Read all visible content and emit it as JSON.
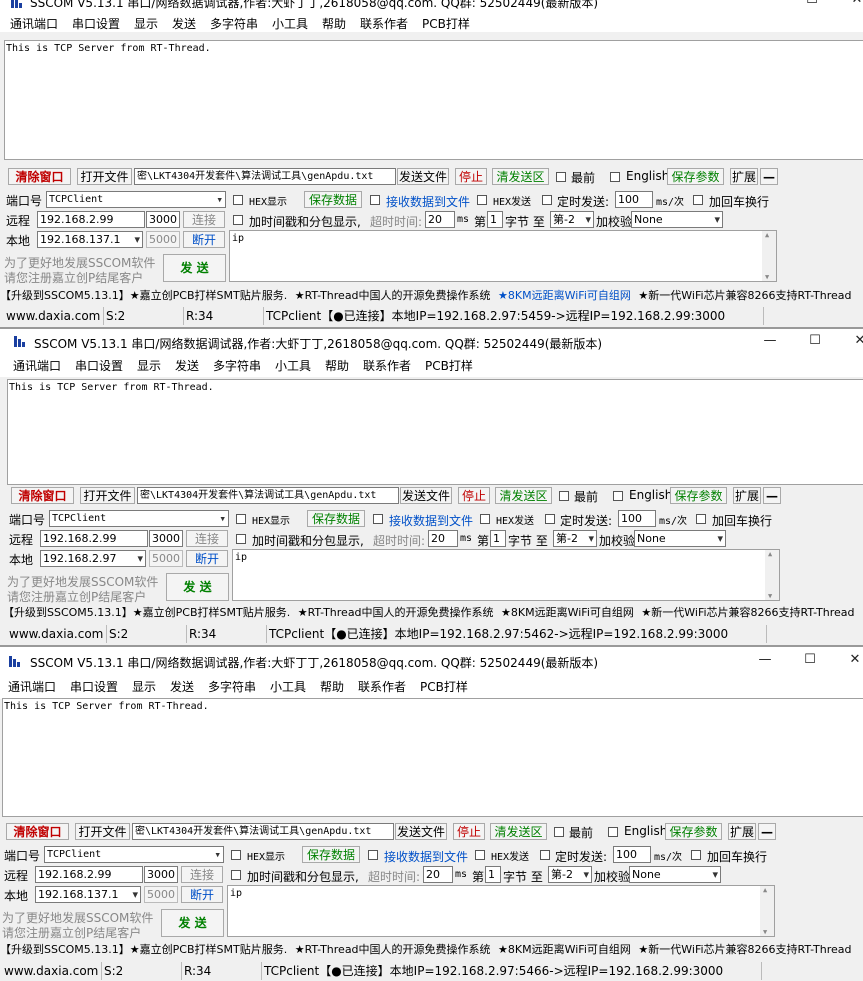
{
  "app": {
    "title": "SSCOM V5.13.1 串口/网络数据调试器,作者:大虾丁丁,2618058@qq.com. QQ群: 52502449(最新版本)",
    "win_min": "—",
    "win_max": "☐",
    "win_close": "✕"
  },
  "menu": [
    "通讯端口",
    "串口设置",
    "显示",
    "发送",
    "多字符串",
    "小工具",
    "帮助",
    "联系作者",
    "PCB打样"
  ],
  "receive_text": "This is TCP Server from RT-Thread.",
  "toolbar": {
    "clear_window": "清除窗口",
    "open_file": "打开文件",
    "file_path": "密\\LKT4304开发套件\\算法调试工具\\genApdu.txt",
    "send_file": "发送文件",
    "stop": "停止",
    "clear_send": "清发送区",
    "topmost": "最前",
    "english": "English",
    "save_params": "保存参数",
    "expand": "扩展",
    "collapse": "—"
  },
  "settings": {
    "port_label": "端口号",
    "port_value": "TCPClient",
    "remote_label": "远程",
    "remote_ip": "192.168.2.99",
    "remote_port": "3000",
    "connect_btn": "连接",
    "local_label": "本地",
    "local_port": "5000",
    "disconnect_btn": "断开",
    "hex_display": "HEX显示",
    "save_data": "保存数据",
    "recv_to_file": "接收数据到文件",
    "hex_send": "HEX发送",
    "timed_send": "定时发送:",
    "timed_value": "100",
    "timed_unit": "ms/次",
    "add_crlf": "加回车换行",
    "timestamp": "加时间戳和分包显示,",
    "timeout_label": "超时时间:",
    "timeout_value": "20",
    "timeout_unit": "ms",
    "byte_no": "第",
    "byte_value": "1",
    "byte_to": "字节 至",
    "byte_end": "第-2",
    "checksum_label": "加校验",
    "checksum_value": "None",
    "send_text": "ip",
    "promo_line1": "为了更好地发展SSCOM软件",
    "promo_line2": "请您注册嘉立创P结尾客户",
    "send_btn": "发 送"
  },
  "ticker": {
    "a": "【升级到SSCOM5.13.1】★嘉立创PCB打样SMT贴片服务.",
    "b": "★RT-Thread中国人的开源免费操作系统",
    "c": "★8KM远距离WiFi可自组网",
    "d": "★新一代WiFi芯片兼容8266支持RT-Thread"
  },
  "windows": [
    {
      "local_ip": "192.168.137.1",
      "status_s": "S:2",
      "status_r": "R:34",
      "status_site": "www.daxia.com",
      "status_conn": "TCPclient【●已连接】本地IP=192.168.2.97:5459->远程IP=192.168.2.99:3000"
    },
    {
      "local_ip": "192.168.2.97",
      "status_s": "S:2",
      "status_r": "R:34",
      "status_site": "www.daxia.com",
      "status_conn": "TCPclient【●已连接】本地IP=192.168.2.97:5462->远程IP=192.168.2.99:3000"
    },
    {
      "local_ip": "192.168.137.1",
      "status_s": "S:2",
      "status_r": "R:34",
      "status_site": "www.daxia.com",
      "status_conn": "TCPclient【●已连接】本地IP=192.168.2.97:5466->远程IP=192.168.2.99:3000"
    }
  ],
  "colors": {
    "red_text": "#c00000",
    "green_text": "#008000",
    "blue_text": "#0050c8"
  }
}
